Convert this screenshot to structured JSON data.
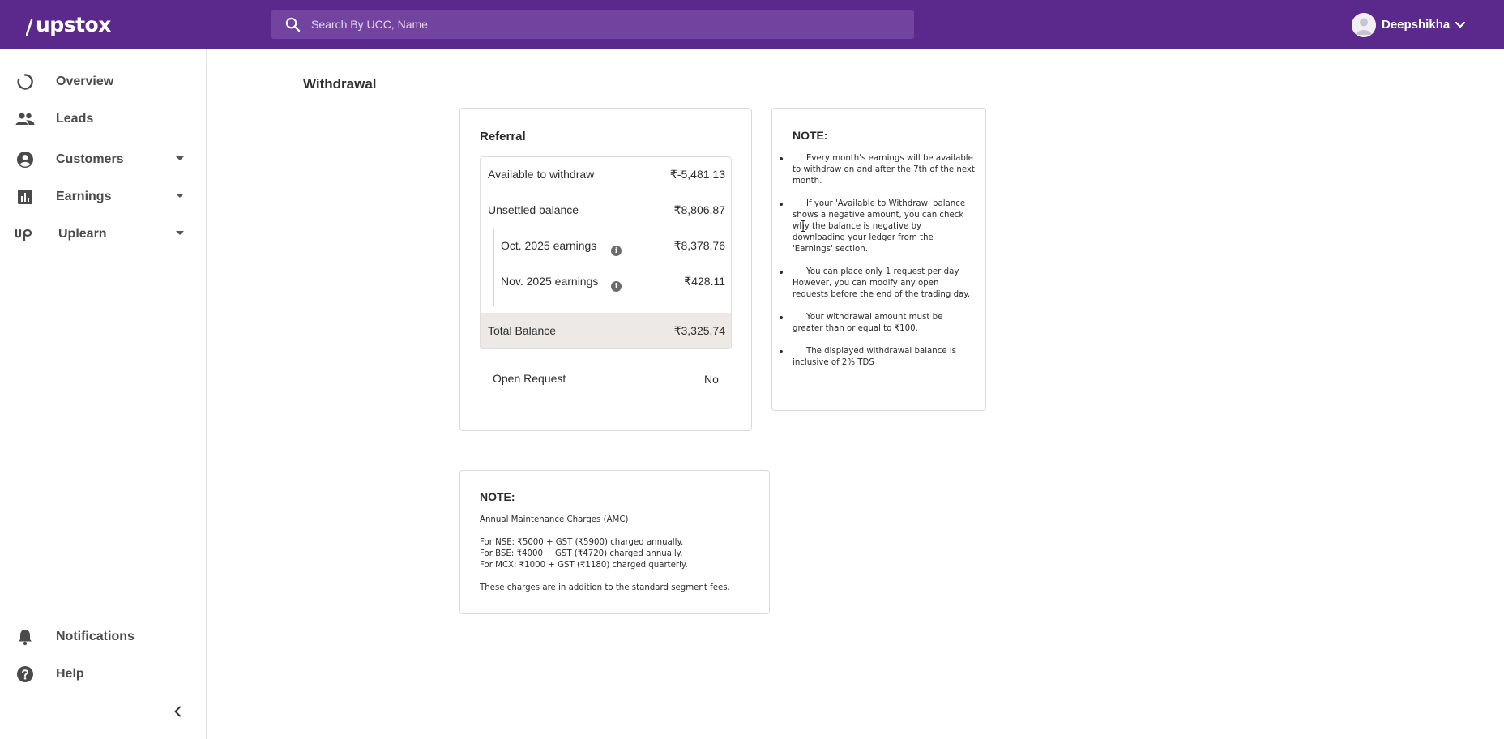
{
  "header": {
    "logo_text": "upstox",
    "search_placeholder": "Search By UCC, Name",
    "user_name": "Deepshikha"
  },
  "sidebar": {
    "items": [
      {
        "label": "Overview",
        "icon": "overview-icon",
        "has_caret": false
      },
      {
        "label": "Leads",
        "icon": "people-icon",
        "has_caret": false
      },
      {
        "label": "Customers",
        "icon": "account-circle-icon",
        "has_caret": true
      },
      {
        "label": "Earnings",
        "icon": "bar-chart-icon",
        "has_caret": true
      },
      {
        "label": "Uplearn",
        "icon": "uplearn-logo-icon",
        "has_caret": true
      }
    ],
    "bottom_items": [
      {
        "label": "Notifications",
        "icon": "bell-icon"
      },
      {
        "label": "Help",
        "icon": "help-icon"
      }
    ],
    "collapse_icon": "chevron-left-icon"
  },
  "page": {
    "title": "Withdrawal"
  },
  "referral": {
    "title": "Referral",
    "rows": [
      {
        "label": "Available to withdraw",
        "value": "₹-5,481.13"
      },
      {
        "label": "Unsettled balance",
        "value": "₹8,806.87"
      },
      {
        "label": "Oct. 2025 earnings",
        "value": "₹8,378.76"
      },
      {
        "label": "Nov. 2025 earnings",
        "value": "₹428.11"
      }
    ],
    "total": {
      "label": "Total Balance",
      "value": "₹3,325.74"
    },
    "open_request": {
      "label": "Open Request",
      "value": "No"
    }
  },
  "note": {
    "title": "NOTE:",
    "items": [
      "Every month's earnings will be available to withdraw on and after the 7th of the next month.",
      "If your 'Available to Withdraw' balance shows a negative amount, you can check why the balance is negative by downloading your ledger from the 'Earnings' section.",
      "You can place only 1 request per day. However, you can modify any open requests before the end of the trading day.",
      "Your withdrawal amount must be greater than or equal to ₹100.",
      "The displayed withdrawal balance is inclusive of 2% TDS"
    ]
  },
  "amc_note": {
    "title": "NOTE:",
    "heading": "Annual Maintenance Charges (AMC)",
    "lines": [
      "For NSE: ₹5000 + GST (₹5900) charged annually.",
      "For BSE: ₹4000 + GST (₹4720) charged annually.",
      "For MCX: ₹1000 + GST (₹1180) charged quarterly."
    ],
    "footer": "These charges are in addition to the standard segment fees."
  },
  "colors": {
    "header_bg": "#5a298b",
    "search_bg": "#73449f",
    "total_row_bg": "#ece9e6"
  }
}
